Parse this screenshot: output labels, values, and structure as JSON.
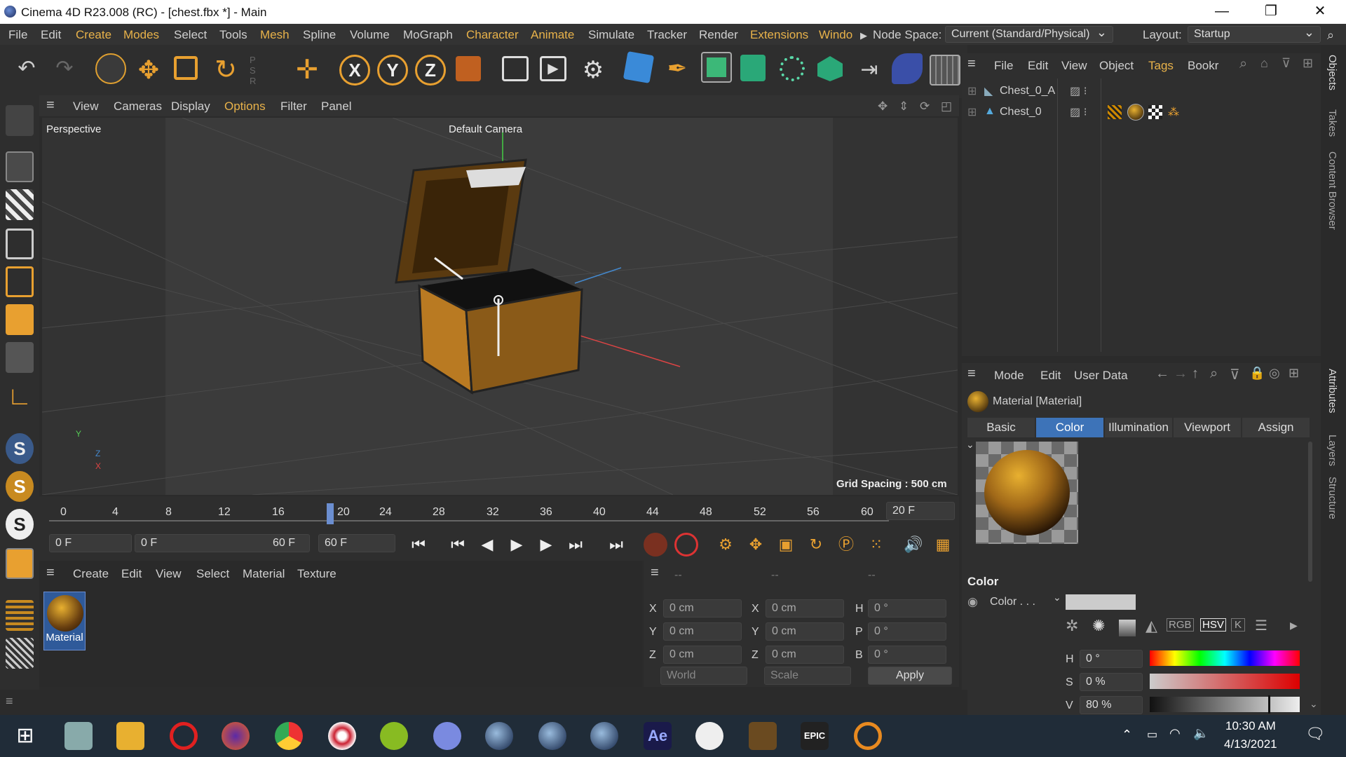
{
  "titlebar": {
    "title": "Cinema 4D R23.008 (RC) - [chest.fbx *] - Main"
  },
  "menubar": {
    "items": [
      "File",
      "Edit",
      "Create",
      "Modes",
      "Select",
      "Tools",
      "Mesh",
      "Spline",
      "Volume",
      "MoGraph",
      "Character",
      "Animate",
      "Simulate",
      "Tracker",
      "Render",
      "Extensions",
      "Windo"
    ],
    "node_space_label": "Node Space:",
    "node_space_value": "Current (Standard/Physical)",
    "layout_label": "Layout:",
    "layout_value": "Startup"
  },
  "viewport": {
    "menu": [
      "View",
      "Cameras",
      "Display",
      "Options",
      "Filter",
      "Panel"
    ],
    "view_name": "Perspective",
    "camera": "Default Camera",
    "grid_spacing": "Grid Spacing : 500 cm",
    "axis_y": "Y",
    "axis_z": "Z",
    "axis_x": "X"
  },
  "timeline": {
    "ticks": [
      "0",
      "4",
      "8",
      "12",
      "16",
      "20",
      "24",
      "28",
      "32",
      "36",
      "40",
      "44",
      "48",
      "52",
      "56",
      "60"
    ],
    "current_frame": "20 F",
    "start": "0 F",
    "range_start": "0 F",
    "range_end": "60 F",
    "end": "60 F"
  },
  "material_manager": {
    "menu": [
      "Create",
      "Edit",
      "View",
      "Select",
      "Material",
      "Texture"
    ],
    "material_name": "Material"
  },
  "coordinates": {
    "headers": [
      "--",
      "--",
      "--"
    ],
    "rows": [
      {
        "a": "X",
        "av": "0 cm",
        "b": "X",
        "bv": "0 cm",
        "c": "H",
        "cv": "0 °"
      },
      {
        "a": "Y",
        "av": "0 cm",
        "b": "Y",
        "bv": "0 cm",
        "c": "P",
        "cv": "0 °"
      },
      {
        "a": "Z",
        "av": "0 cm",
        "b": "Z",
        "bv": "0 cm",
        "c": "B",
        "cv": "0 °"
      }
    ],
    "world": "World",
    "scale": "Scale",
    "apply": "Apply"
  },
  "objects": {
    "menu": [
      "File",
      "Edit",
      "View",
      "Object",
      "Tags",
      "Bookr"
    ],
    "items": [
      "Chest_0_A",
      "Chest_0"
    ]
  },
  "attributes": {
    "menu": [
      "Mode",
      "Edit",
      "User Data"
    ],
    "title": "Material [Material]",
    "tabs": [
      "Basic",
      "Color",
      "Illumination",
      "Viewport",
      "Assign"
    ],
    "section": "Color",
    "color_label": "Color . . .",
    "modes": [
      "RGB",
      "HSV",
      "K"
    ],
    "h_label": "H",
    "h_value": "0 °",
    "s_label": "S",
    "s_value": "0 %",
    "v_label": "V",
    "v_value": "80 %",
    "v_level": 0.8
  },
  "right_strip": [
    "Objects",
    "Takes",
    "Content Browser",
    "Attributes",
    "Layers",
    "Structure"
  ],
  "taskbar": {
    "time": "10:30 AM",
    "date": "4/13/2021",
    "ae_label": "Ae"
  }
}
